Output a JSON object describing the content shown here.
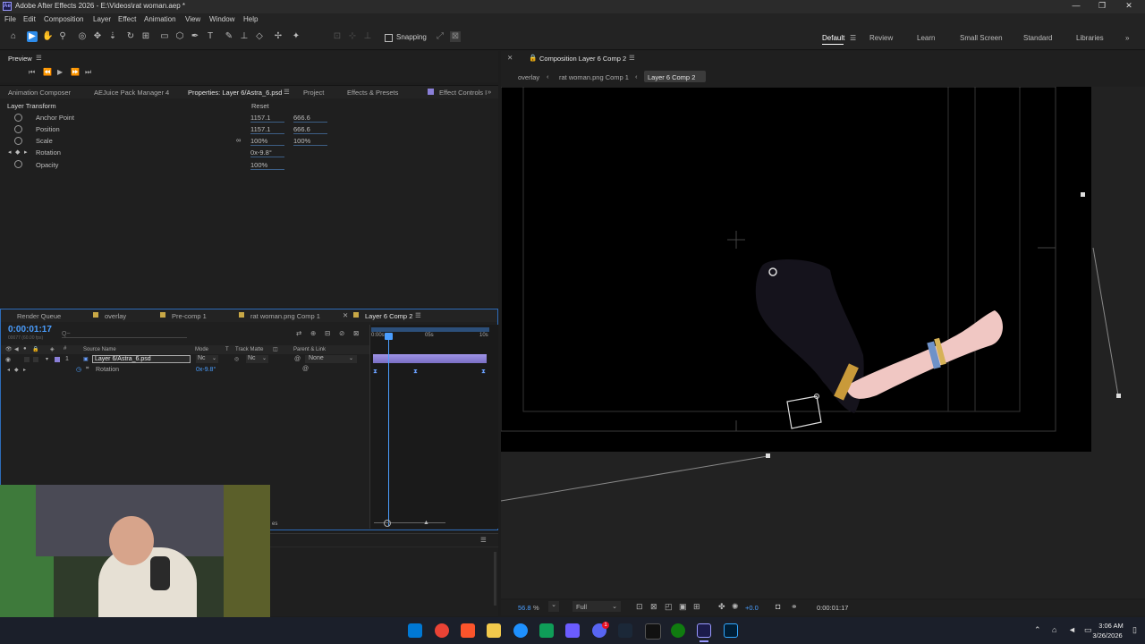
{
  "titlebar": {
    "title": "Adobe After Effects 2026 - E:\\Videos\\rat woman.aep *",
    "logo": "Ae",
    "min": "—",
    "max": "❐",
    "close": "✕"
  },
  "menu": [
    "File",
    "Edit",
    "Composition",
    "Layer",
    "Effect",
    "Animation",
    "View",
    "Window",
    "Help"
  ],
  "toolbar": {
    "snapping_label": "Snapping",
    "workspaces": [
      "Default",
      "Review",
      "Learn",
      "Small Screen",
      "Standard",
      "Libraries"
    ],
    "active_workspace": "Default",
    "more": "»"
  },
  "preview": {
    "title": "Preview"
  },
  "left_tabs": [
    "Animation Composer",
    "AEJuice Pack Manager 4",
    "Properties: Layer 6/Astra_6.psd",
    "Project",
    "Effects & Presets",
    "Effect Controls I"
  ],
  "properties": {
    "section": "Layer Transform",
    "reset": "Reset",
    "rows": [
      {
        "name": "Anchor Point",
        "v1": "1157.1",
        "v2": "666.6"
      },
      {
        "name": "Position",
        "v1": "1157.1",
        "v2": "666.6"
      },
      {
        "name": "Scale",
        "v1": "100%",
        "v2": "100%"
      },
      {
        "name": "Rotation",
        "v1": "0x-9.8°",
        "v2": ""
      },
      {
        "name": "Opacity",
        "v1": "100%",
        "v2": ""
      }
    ]
  },
  "timeline": {
    "tabs": [
      "Render Queue",
      "overlay",
      "Pre-comp 1",
      "rat woman.png Comp 1",
      "Layer 6 Comp 2"
    ],
    "timecode": "0:00:01:17",
    "fps": "00077 (60.00 fps)",
    "search_placeholder": "Q~",
    "columns": {
      "source": "Source Name",
      "mode": "Mode",
      "t": "T",
      "matte": "Track Matte",
      "parent": "Parent & Link"
    },
    "ruler": [
      "0:00s",
      "05s",
      "10s"
    ],
    "layer": {
      "index": "1",
      "name": "Layer 6/Astra_6.psd",
      "mode": "Nc",
      "matte": "Nc",
      "parent": "None"
    },
    "subprop": {
      "name": "Rotation",
      "value": "0x-9.8°"
    },
    "footer_text": "es"
  },
  "composition": {
    "tab_title": "Composition Layer 6 Comp 2",
    "breadcrumbs": [
      "overlay",
      "rat woman.png Comp 1",
      "Layer 6 Comp 2"
    ],
    "zoom": "56.8",
    "zoom_unit": "%",
    "resolution": "Full",
    "exposure": "+0.0",
    "timecode": "0:00:01:17"
  },
  "taskbar": {
    "time": "3:06 AM",
    "date": "3/26/2026",
    "icon_colors": [
      "#0078d4",
      "#ea4335",
      "#fb542b",
      "#f2c94c",
      "#1e90ff",
      "#0f9d58",
      "#6b5cff",
      "#1b2838",
      "#111",
      "#107c10",
      "#9999ff",
      "#31a8ff"
    ],
    "notification": "1"
  }
}
